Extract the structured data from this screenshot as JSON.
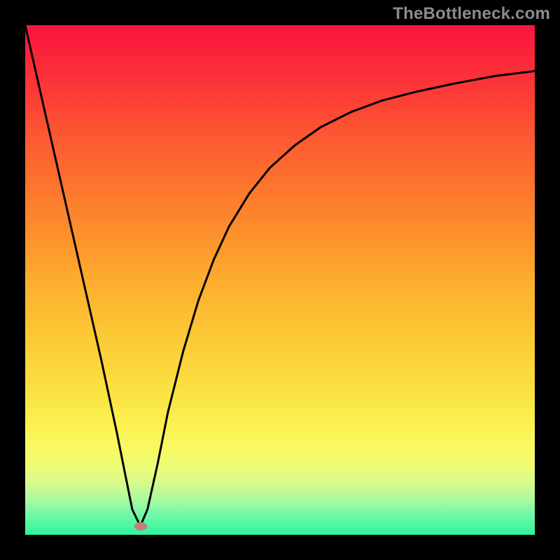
{
  "watermark": {
    "text": "TheBottleneck.com"
  },
  "marker": {
    "x_pct": 22.6,
    "y_pct": 98.3,
    "color": "#c97a79"
  },
  "gradient": {
    "stops": [
      {
        "offset": 0,
        "color": "#f9153e"
      },
      {
        "offset": 10,
        "color": "#fb3038"
      },
      {
        "offset": 20,
        "color": "#fc5232"
      },
      {
        "offset": 30,
        "color": "#fd702e"
      },
      {
        "offset": 40,
        "color": "#fd8d2d"
      },
      {
        "offset": 50,
        "color": "#fdac2e"
      },
      {
        "offset": 60,
        "color": "#fcc734"
      },
      {
        "offset": 70,
        "color": "#fbdd3f"
      },
      {
        "offset": 78,
        "color": "#faf04f"
      },
      {
        "offset": 83,
        "color": "#f8f963"
      },
      {
        "offset": 87,
        "color": "#edfa78"
      },
      {
        "offset": 90,
        "color": "#d5fa8d"
      },
      {
        "offset": 93,
        "color": "#abfa9f"
      },
      {
        "offset": 96,
        "color": "#71f8a7"
      },
      {
        "offset": 100,
        "color": "#2df69c"
      }
    ]
  },
  "chart_data": {
    "type": "line",
    "title": "",
    "xlabel": "",
    "ylabel": "",
    "xlim": [
      0,
      100
    ],
    "ylim": [
      0,
      100
    ],
    "axes_visible": false,
    "background": "vertical-gradient",
    "series": [
      {
        "name": "curve",
        "x": [
          0,
          5,
          10,
          15,
          18,
          20,
          21,
          22.6,
          24,
          26,
          28,
          31,
          34,
          37,
          40,
          44,
          48,
          53,
          58,
          64,
          70,
          77,
          84,
          92,
          100
        ],
        "y": [
          100,
          78.0,
          56.0,
          34.0,
          20.0,
          10.0,
          5.0,
          1.7,
          5.0,
          14.0,
          24.0,
          36.0,
          46.0,
          54.0,
          60.5,
          67.0,
          72.0,
          76.5,
          80.0,
          83.0,
          85.2,
          87.0,
          88.5,
          90.0,
          91.0
        ]
      }
    ],
    "marker_point": {
      "x": 22.6,
      "y": 1.7
    },
    "notes": "x and y in percent of the plotting area; y=0 is the bottom edge. Values estimated from pixels."
  }
}
